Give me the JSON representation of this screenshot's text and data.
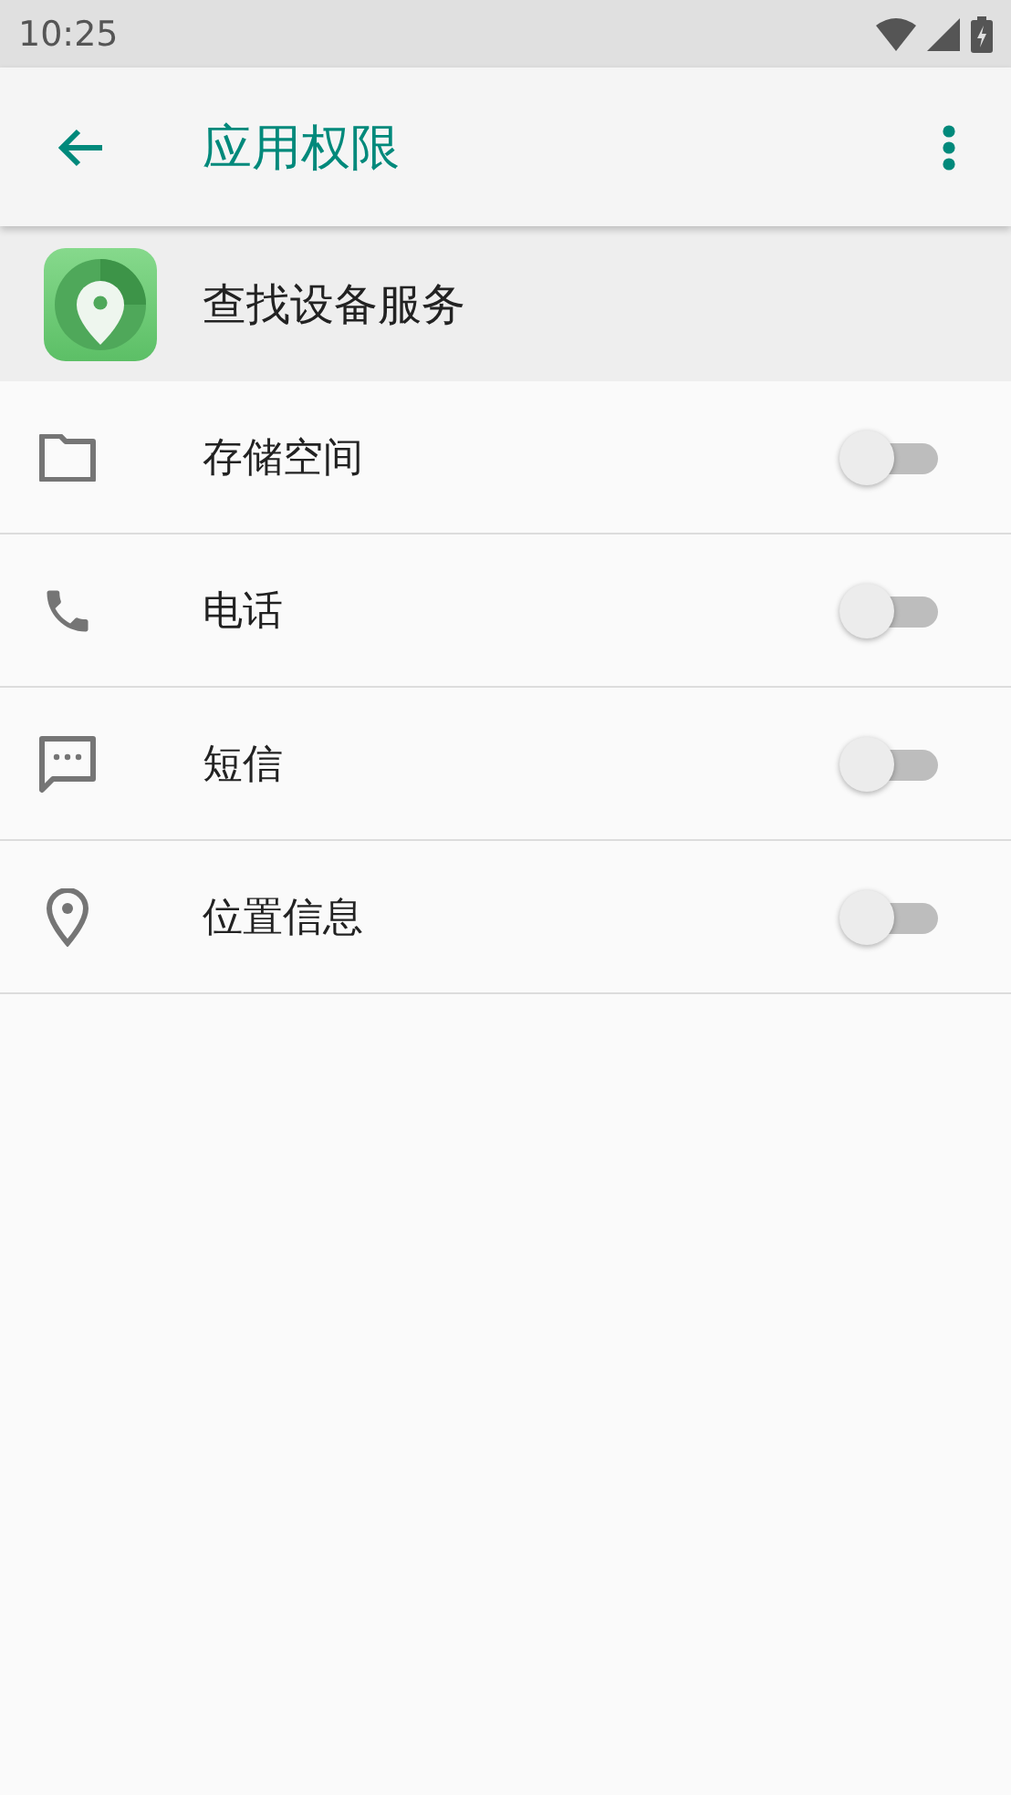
{
  "status_bar": {
    "time": "10:25"
  },
  "app_bar": {
    "title": "应用权限"
  },
  "app": {
    "name": "查找设备服务"
  },
  "permissions": [
    {
      "kind": "folder",
      "label": "存储空间",
      "on": false
    },
    {
      "kind": "phone",
      "label": "电话",
      "on": false
    },
    {
      "kind": "message",
      "label": "短信",
      "on": false
    },
    {
      "kind": "location",
      "label": "位置信息",
      "on": false
    }
  ]
}
